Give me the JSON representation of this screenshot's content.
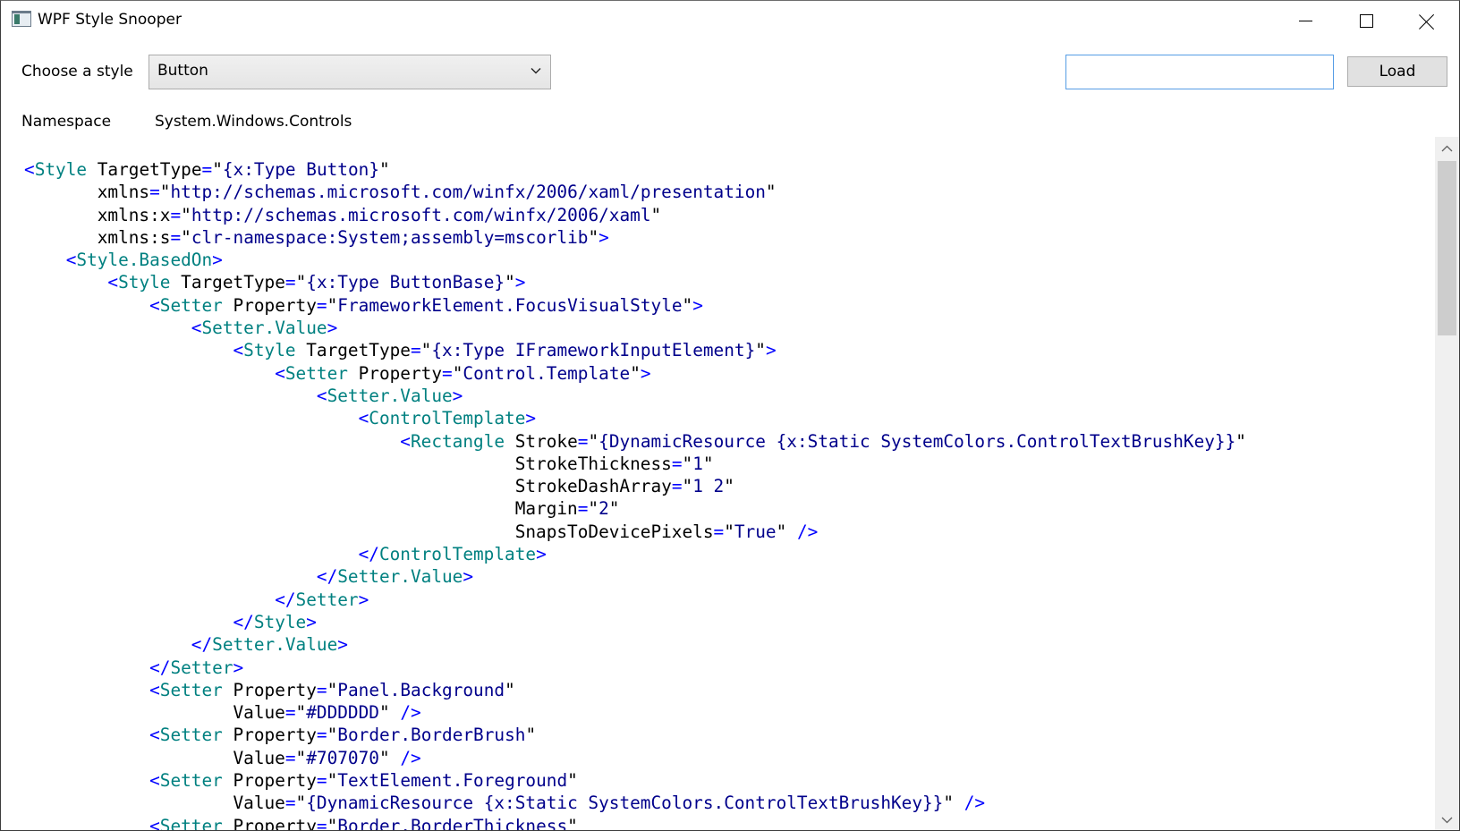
{
  "window": {
    "title": "WPF Style Snooper"
  },
  "controls": {
    "choose_label": "Choose a style",
    "style_selected": "Button",
    "path_input_value": "",
    "load_label": "Load",
    "namespace_label": "Namespace",
    "namespace_value": "System.Windows.Controls"
  },
  "icons": {
    "app": "app-icon",
    "minimize": "minimize-icon",
    "maximize": "maximize-icon",
    "close": "close-icon",
    "dropdown": "chevron-down-icon",
    "scroll_up": "scroll-up-arrow-icon",
    "scroll_down": "scroll-down-arrow-icon"
  },
  "colors": {
    "punctuation": "#0000ff",
    "tag": "#008080",
    "attribute": "#000000",
    "value": "#00008b",
    "focus_border": "#569de5"
  },
  "scroll": {
    "position_fraction": 0.0,
    "visible_fraction": 0.27
  },
  "xaml_lines": [
    [
      [
        "p",
        "<"
      ],
      [
        "t",
        "Style"
      ],
      [
        "x",
        " "
      ],
      [
        "a",
        "TargetType"
      ],
      [
        "p",
        "="
      ],
      [
        "x",
        "\""
      ],
      [
        "v",
        "{x:Type Button}"
      ],
      [
        "x",
        "\""
      ]
    ],
    [
      [
        "x",
        "       "
      ],
      [
        "a",
        "xmlns"
      ],
      [
        "p",
        "="
      ],
      [
        "x",
        "\""
      ],
      [
        "v",
        "http://schemas.microsoft.com/winfx/2006/xaml/presentation"
      ],
      [
        "x",
        "\""
      ]
    ],
    [
      [
        "x",
        "       "
      ],
      [
        "a",
        "xmlns:x"
      ],
      [
        "p",
        "="
      ],
      [
        "x",
        "\""
      ],
      [
        "v",
        "http://schemas.microsoft.com/winfx/2006/xaml"
      ],
      [
        "x",
        "\""
      ]
    ],
    [
      [
        "x",
        "       "
      ],
      [
        "a",
        "xmlns:s"
      ],
      [
        "p",
        "="
      ],
      [
        "x",
        "\""
      ],
      [
        "v",
        "clr-namespace:System;assembly=mscorlib"
      ],
      [
        "x",
        "\""
      ],
      [
        "p",
        ">"
      ]
    ],
    [
      [
        "x",
        "    "
      ],
      [
        "p",
        "<"
      ],
      [
        "t",
        "Style.BasedOn"
      ],
      [
        "p",
        ">"
      ]
    ],
    [
      [
        "x",
        "        "
      ],
      [
        "p",
        "<"
      ],
      [
        "t",
        "Style"
      ],
      [
        "x",
        " "
      ],
      [
        "a",
        "TargetType"
      ],
      [
        "p",
        "="
      ],
      [
        "x",
        "\""
      ],
      [
        "v",
        "{x:Type ButtonBase}"
      ],
      [
        "x",
        "\""
      ],
      [
        "p",
        ">"
      ]
    ],
    [
      [
        "x",
        "            "
      ],
      [
        "p",
        "<"
      ],
      [
        "t",
        "Setter"
      ],
      [
        "x",
        " "
      ],
      [
        "a",
        "Property"
      ],
      [
        "p",
        "="
      ],
      [
        "x",
        "\""
      ],
      [
        "v",
        "FrameworkElement.FocusVisualStyle"
      ],
      [
        "x",
        "\""
      ],
      [
        "p",
        ">"
      ]
    ],
    [
      [
        "x",
        "                "
      ],
      [
        "p",
        "<"
      ],
      [
        "t",
        "Setter.Value"
      ],
      [
        "p",
        ">"
      ]
    ],
    [
      [
        "x",
        "                    "
      ],
      [
        "p",
        "<"
      ],
      [
        "t",
        "Style"
      ],
      [
        "x",
        " "
      ],
      [
        "a",
        "TargetType"
      ],
      [
        "p",
        "="
      ],
      [
        "x",
        "\""
      ],
      [
        "v",
        "{x:Type IFrameworkInputElement}"
      ],
      [
        "x",
        "\""
      ],
      [
        "p",
        ">"
      ]
    ],
    [
      [
        "x",
        "                        "
      ],
      [
        "p",
        "<"
      ],
      [
        "t",
        "Setter"
      ],
      [
        "x",
        " "
      ],
      [
        "a",
        "Property"
      ],
      [
        "p",
        "="
      ],
      [
        "x",
        "\""
      ],
      [
        "v",
        "Control.Template"
      ],
      [
        "x",
        "\""
      ],
      [
        "p",
        ">"
      ]
    ],
    [
      [
        "x",
        "                            "
      ],
      [
        "p",
        "<"
      ],
      [
        "t",
        "Setter.Value"
      ],
      [
        "p",
        ">"
      ]
    ],
    [
      [
        "x",
        "                                "
      ],
      [
        "p",
        "<"
      ],
      [
        "t",
        "ControlTemplate"
      ],
      [
        "p",
        ">"
      ]
    ],
    [
      [
        "x",
        "                                    "
      ],
      [
        "p",
        "<"
      ],
      [
        "t",
        "Rectangle"
      ],
      [
        "x",
        " "
      ],
      [
        "a",
        "Stroke"
      ],
      [
        "p",
        "="
      ],
      [
        "x",
        "\""
      ],
      [
        "v",
        "{DynamicResource {x:Static SystemColors.ControlTextBrushKey}}"
      ],
      [
        "x",
        "\""
      ]
    ],
    [
      [
        "x",
        "                                               "
      ],
      [
        "a",
        "StrokeThickness"
      ],
      [
        "p",
        "="
      ],
      [
        "x",
        "\""
      ],
      [
        "v",
        "1"
      ],
      [
        "x",
        "\""
      ]
    ],
    [
      [
        "x",
        "                                               "
      ],
      [
        "a",
        "StrokeDashArray"
      ],
      [
        "p",
        "="
      ],
      [
        "x",
        "\""
      ],
      [
        "v",
        "1 2"
      ],
      [
        "x",
        "\""
      ]
    ],
    [
      [
        "x",
        "                                               "
      ],
      [
        "a",
        "Margin"
      ],
      [
        "p",
        "="
      ],
      [
        "x",
        "\""
      ],
      [
        "v",
        "2"
      ],
      [
        "x",
        "\""
      ]
    ],
    [
      [
        "x",
        "                                               "
      ],
      [
        "a",
        "SnapsToDevicePixels"
      ],
      [
        "p",
        "="
      ],
      [
        "x",
        "\""
      ],
      [
        "v",
        "True"
      ],
      [
        "x",
        "\" "
      ],
      [
        "p",
        "/>"
      ]
    ],
    [
      [
        "x",
        "                                "
      ],
      [
        "p",
        "</"
      ],
      [
        "t",
        "ControlTemplate"
      ],
      [
        "p",
        ">"
      ]
    ],
    [
      [
        "x",
        "                            "
      ],
      [
        "p",
        "</"
      ],
      [
        "t",
        "Setter.Value"
      ],
      [
        "p",
        ">"
      ]
    ],
    [
      [
        "x",
        "                        "
      ],
      [
        "p",
        "</"
      ],
      [
        "t",
        "Setter"
      ],
      [
        "p",
        ">"
      ]
    ],
    [
      [
        "x",
        "                    "
      ],
      [
        "p",
        "</"
      ],
      [
        "t",
        "Style"
      ],
      [
        "p",
        ">"
      ]
    ],
    [
      [
        "x",
        "                "
      ],
      [
        "p",
        "</"
      ],
      [
        "t",
        "Setter.Value"
      ],
      [
        "p",
        ">"
      ]
    ],
    [
      [
        "x",
        "            "
      ],
      [
        "p",
        "</"
      ],
      [
        "t",
        "Setter"
      ],
      [
        "p",
        ">"
      ]
    ],
    [
      [
        "x",
        "            "
      ],
      [
        "p",
        "<"
      ],
      [
        "t",
        "Setter"
      ],
      [
        "x",
        " "
      ],
      [
        "a",
        "Property"
      ],
      [
        "p",
        "="
      ],
      [
        "x",
        "\""
      ],
      [
        "v",
        "Panel.Background"
      ],
      [
        "x",
        "\""
      ]
    ],
    [
      [
        "x",
        "                    "
      ],
      [
        "a",
        "Value"
      ],
      [
        "p",
        "="
      ],
      [
        "x",
        "\""
      ],
      [
        "v",
        "#DDDDDD"
      ],
      [
        "x",
        "\" "
      ],
      [
        "p",
        "/>"
      ]
    ],
    [
      [
        "x",
        "            "
      ],
      [
        "p",
        "<"
      ],
      [
        "t",
        "Setter"
      ],
      [
        "x",
        " "
      ],
      [
        "a",
        "Property"
      ],
      [
        "p",
        "="
      ],
      [
        "x",
        "\""
      ],
      [
        "v",
        "Border.BorderBrush"
      ],
      [
        "x",
        "\""
      ]
    ],
    [
      [
        "x",
        "                    "
      ],
      [
        "a",
        "Value"
      ],
      [
        "p",
        "="
      ],
      [
        "x",
        "\""
      ],
      [
        "v",
        "#707070"
      ],
      [
        "x",
        "\" "
      ],
      [
        "p",
        "/>"
      ]
    ],
    [
      [
        "x",
        "            "
      ],
      [
        "p",
        "<"
      ],
      [
        "t",
        "Setter"
      ],
      [
        "x",
        " "
      ],
      [
        "a",
        "Property"
      ],
      [
        "p",
        "="
      ],
      [
        "x",
        "\""
      ],
      [
        "v",
        "TextElement.Foreground"
      ],
      [
        "x",
        "\""
      ]
    ],
    [
      [
        "x",
        "                    "
      ],
      [
        "a",
        "Value"
      ],
      [
        "p",
        "="
      ],
      [
        "x",
        "\""
      ],
      [
        "v",
        "{DynamicResource {x:Static SystemColors.ControlTextBrushKey}}"
      ],
      [
        "x",
        "\" "
      ],
      [
        "p",
        "/>"
      ]
    ],
    [
      [
        "x",
        "            "
      ],
      [
        "p",
        "<"
      ],
      [
        "t",
        "Setter"
      ],
      [
        "x",
        " "
      ],
      [
        "a",
        "Property"
      ],
      [
        "p",
        "="
      ],
      [
        "x",
        "\""
      ],
      [
        "v",
        "Border.BorderThickness"
      ],
      [
        "x",
        "\""
      ]
    ]
  ]
}
